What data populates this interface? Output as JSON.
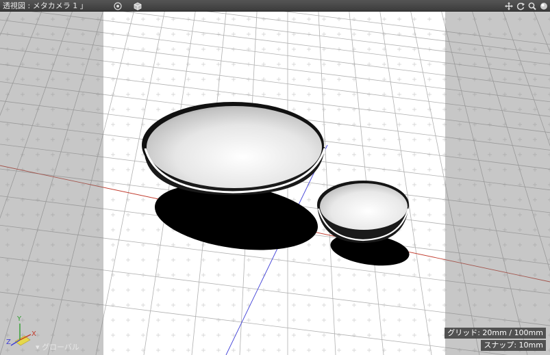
{
  "window": {
    "title": "透視図 : メタカメラ 1 」"
  },
  "toolbar": {
    "left_icons": [
      "target-icon",
      "cube-icon"
    ],
    "right_icons": [
      "move-icon",
      "rotate-icon",
      "zoom-icon",
      "sphere-icon"
    ]
  },
  "viewport": {
    "grid_label": "グリッド: 20mm / 100mm",
    "snap_label": "スナップ: 10mm",
    "coordinate_system": "▾ グローバル",
    "axes": [
      "Y",
      "X",
      "Z"
    ]
  },
  "colors": {
    "x_axis": "#c0392b",
    "z_axis": "#3b3bd6",
    "y_axis": "#3aa83a"
  }
}
